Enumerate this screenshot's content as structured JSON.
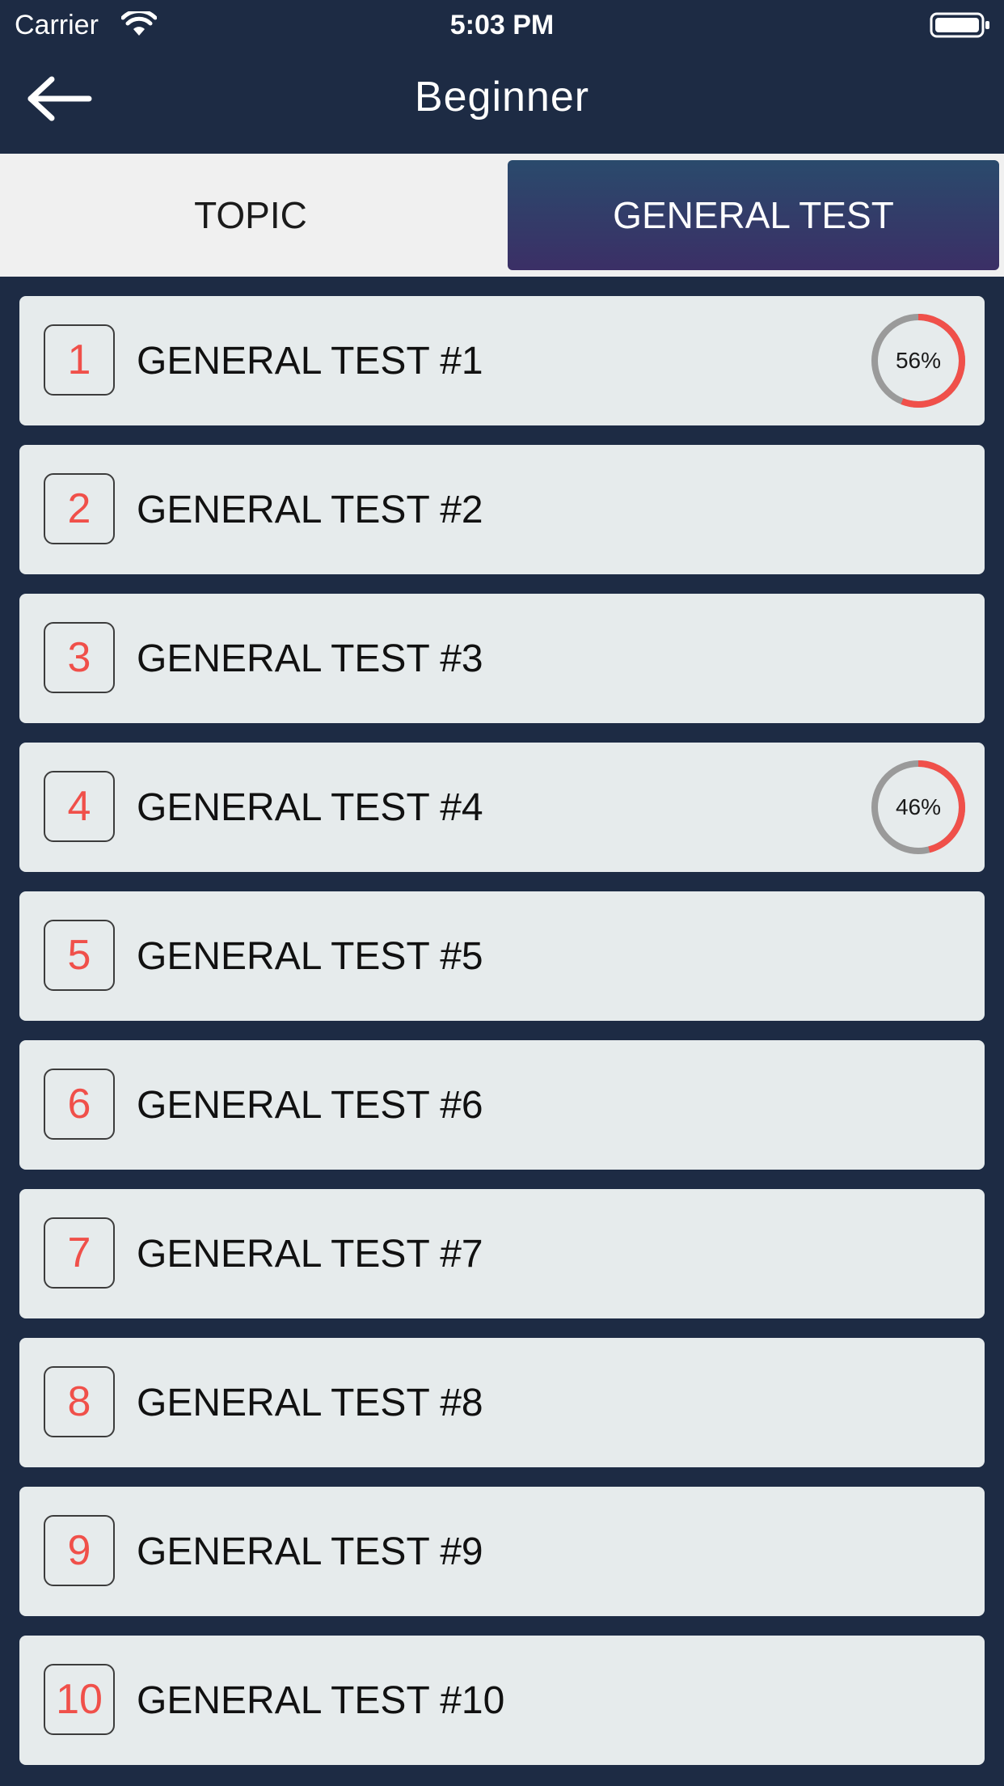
{
  "status_bar": {
    "carrier": "Carrier",
    "time": "5:03 PM",
    "wifi_icon": "wifi-icon",
    "battery_icon": "battery-icon"
  },
  "nav": {
    "title": "Beginner",
    "back_icon": "back-arrow-icon"
  },
  "tabs": [
    {
      "label": "TOPIC",
      "active": false
    },
    {
      "label": "GENERAL TEST",
      "active": true
    }
  ],
  "colors": {
    "background": "#1d2b44",
    "accent_red": "#f0504a",
    "ring_track": "#9a9a9a",
    "active_tab_top": "#2a4a6c",
    "active_tab_bottom": "#3b2f66",
    "row_background": "#e6ebec"
  },
  "tests": [
    {
      "number": "1",
      "label": "GENERAL TEST #1",
      "progress_label": "56%",
      "progress": 0.56
    },
    {
      "number": "2",
      "label": "GENERAL TEST #2"
    },
    {
      "number": "3",
      "label": "GENERAL TEST #3"
    },
    {
      "number": "4",
      "label": "GENERAL TEST #4",
      "progress_label": "46%",
      "progress": 0.46
    },
    {
      "number": "5",
      "label": "GENERAL TEST #5"
    },
    {
      "number": "6",
      "label": "GENERAL TEST #6"
    },
    {
      "number": "7",
      "label": "GENERAL TEST #7"
    },
    {
      "number": "8",
      "label": "GENERAL TEST #8"
    },
    {
      "number": "9",
      "label": "GENERAL TEST #9"
    },
    {
      "number": "10",
      "label": "GENERAL TEST #10"
    }
  ]
}
